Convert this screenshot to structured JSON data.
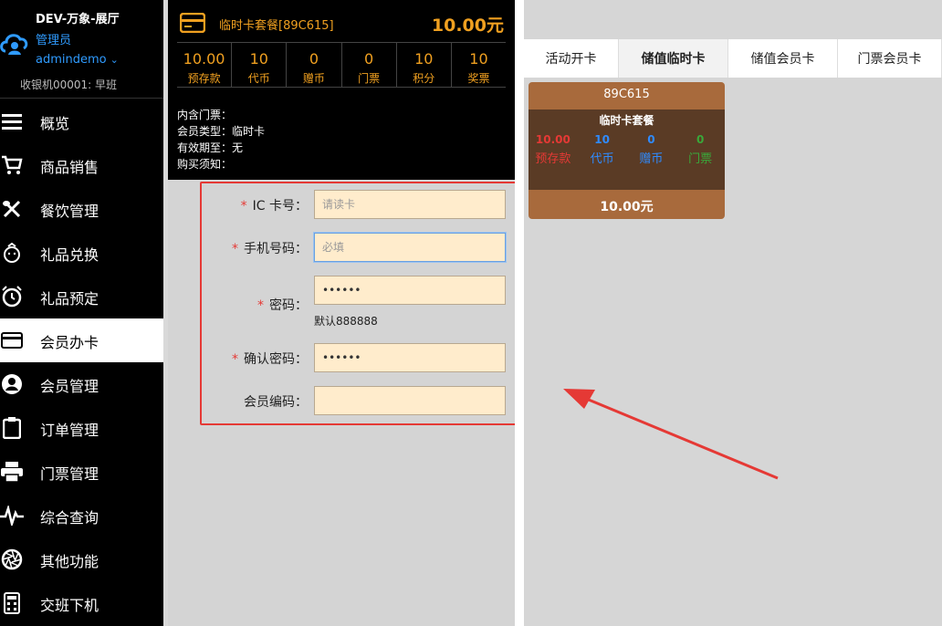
{
  "brand": {
    "store": "DEV-万象-展厅",
    "role": "管理员",
    "user": "admindemo",
    "shift": "收银机00001: 早班"
  },
  "nav": [
    {
      "label": "概览",
      "icon": "menu-icon"
    },
    {
      "label": "商品销售",
      "icon": "cart-icon"
    },
    {
      "label": "餐饮管理",
      "icon": "utensils-icon"
    },
    {
      "label": "礼品兑换",
      "icon": "gift-icon"
    },
    {
      "label": "礼品预定",
      "icon": "alarm-icon"
    },
    {
      "label": "会员办卡",
      "icon": "card-icon"
    },
    {
      "label": "会员管理",
      "icon": "user-icon"
    },
    {
      "label": "订单管理",
      "icon": "clipboard-icon"
    },
    {
      "label": "门票管理",
      "icon": "printer-icon"
    },
    {
      "label": "综合查询",
      "icon": "pulse-icon"
    },
    {
      "label": "其他功能",
      "icon": "aperture-icon"
    },
    {
      "label": "交班下机",
      "icon": "calculator-icon"
    }
  ],
  "nav_active": "会员办卡",
  "card": {
    "title": "临时卡套餐[89C615]",
    "price": "10.00元",
    "stats": [
      {
        "value": "10.00",
        "label": "预存款"
      },
      {
        "value": "10",
        "label": "代币"
      },
      {
        "value": "0",
        "label": "赠币"
      },
      {
        "value": "0",
        "label": "门票"
      },
      {
        "value": "10",
        "label": "积分"
      },
      {
        "value": "10",
        "label": "奖票"
      }
    ],
    "info": [
      "内含门票：",
      "会员类型：临时卡",
      "有效期至：无",
      "购买须知："
    ]
  },
  "form": {
    "ic": {
      "label": "IC 卡号：",
      "placeholder": "请读卡",
      "value": ""
    },
    "phone": {
      "label": "手机号码：",
      "placeholder": "必填",
      "value": ""
    },
    "password": {
      "label": "密码：",
      "value": "888888"
    },
    "password_hint": "默认888888",
    "confirm": {
      "label": "确认密码：",
      "value": "888888"
    },
    "member_no": {
      "label": "会员编码：",
      "value": ""
    }
  },
  "tabs": [
    "活动开卡",
    "储值临时卡",
    "储值会员卡",
    "门票会员卡"
  ],
  "tab_active": "储值临时卡",
  "package": {
    "code": "89C615",
    "name": "临时卡套餐",
    "cells": [
      {
        "value": "10.00",
        "label": "预存款",
        "color": "#e53935"
      },
      {
        "value": "10",
        "label": "代币",
        "color": "#2f8bff"
      },
      {
        "value": "0",
        "label": "赠币",
        "color": "#2f8bff"
      },
      {
        "value": "0",
        "label": "门票",
        "color": "#3aa83a"
      }
    ],
    "price": "10.00元"
  },
  "colors": {
    "accent": "#f0a020",
    "highlight": "#e53935",
    "link": "#2f9bff",
    "input_bg": "#ffeccc",
    "card_bg": "#a86a3c"
  }
}
